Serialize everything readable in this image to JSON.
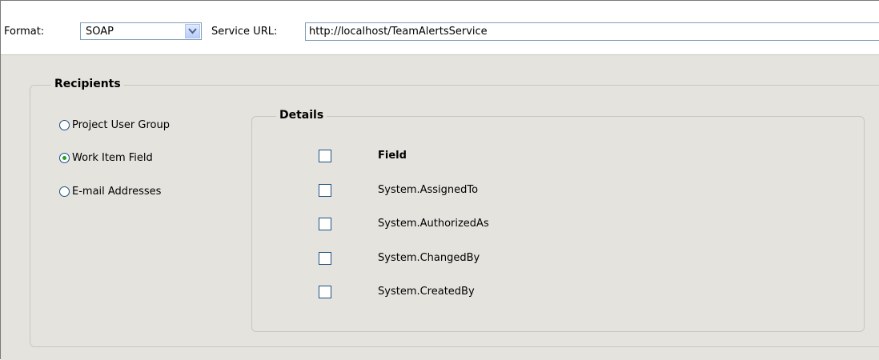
{
  "toolbar": {
    "format_label": "Format:",
    "format_value": "SOAP",
    "service_url_label": "Service URL:",
    "service_url_value": "http://localhost/TeamAlertsService"
  },
  "recipients": {
    "title": "Recipients",
    "options": [
      {
        "label": "Project User Group",
        "checked": false
      },
      {
        "label": "Work Item Field",
        "checked": true
      },
      {
        "label": "E-mail Addresses",
        "checked": false
      }
    ]
  },
  "details": {
    "title": "Details",
    "header": "Field",
    "rows": [
      {
        "field": "System.AssignedTo",
        "checked": false
      },
      {
        "field": "System.AuthorizedAs",
        "checked": false
      },
      {
        "field": "System.ChangedBy",
        "checked": false
      },
      {
        "field": "System.CreatedBy",
        "checked": false
      }
    ]
  },
  "icons": {
    "dropdown": "chevron-down-icon"
  },
  "colors": {
    "panel_bg": "#e5e3de",
    "border": "#7f9db9",
    "radio_dot": "#21a121"
  }
}
